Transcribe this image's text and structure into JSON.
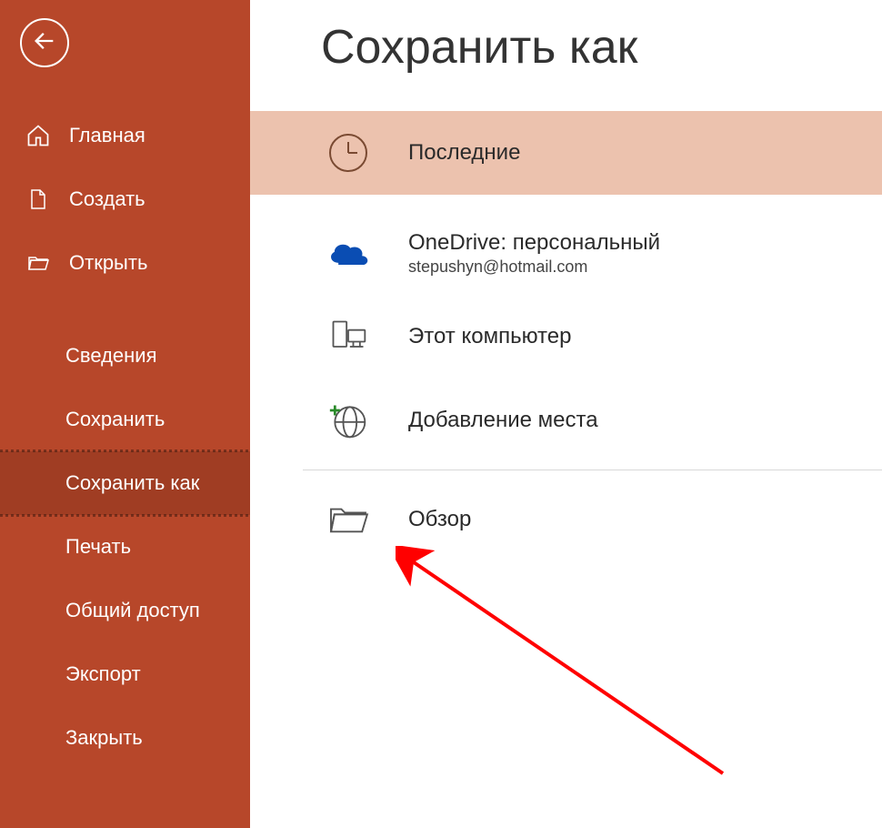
{
  "page": {
    "title": "Сохранить как"
  },
  "nav": {
    "home": "Главная",
    "new": "Создать",
    "open": "Открыть",
    "info": "Сведения",
    "save": "Сохранить",
    "saveas": "Сохранить как",
    "print": "Печать",
    "share": "Общий доступ",
    "export": "Экспорт",
    "close": "Закрыть"
  },
  "locations": {
    "recent": {
      "label": "Последние"
    },
    "onedrive": {
      "label": "OneDrive: персональный",
      "sub": "stepushyn@hotmail.com"
    },
    "thispc": {
      "label": "Этот компьютер"
    },
    "addplace": {
      "label": "Добавление места"
    },
    "browse": {
      "label": "Обзор"
    }
  }
}
